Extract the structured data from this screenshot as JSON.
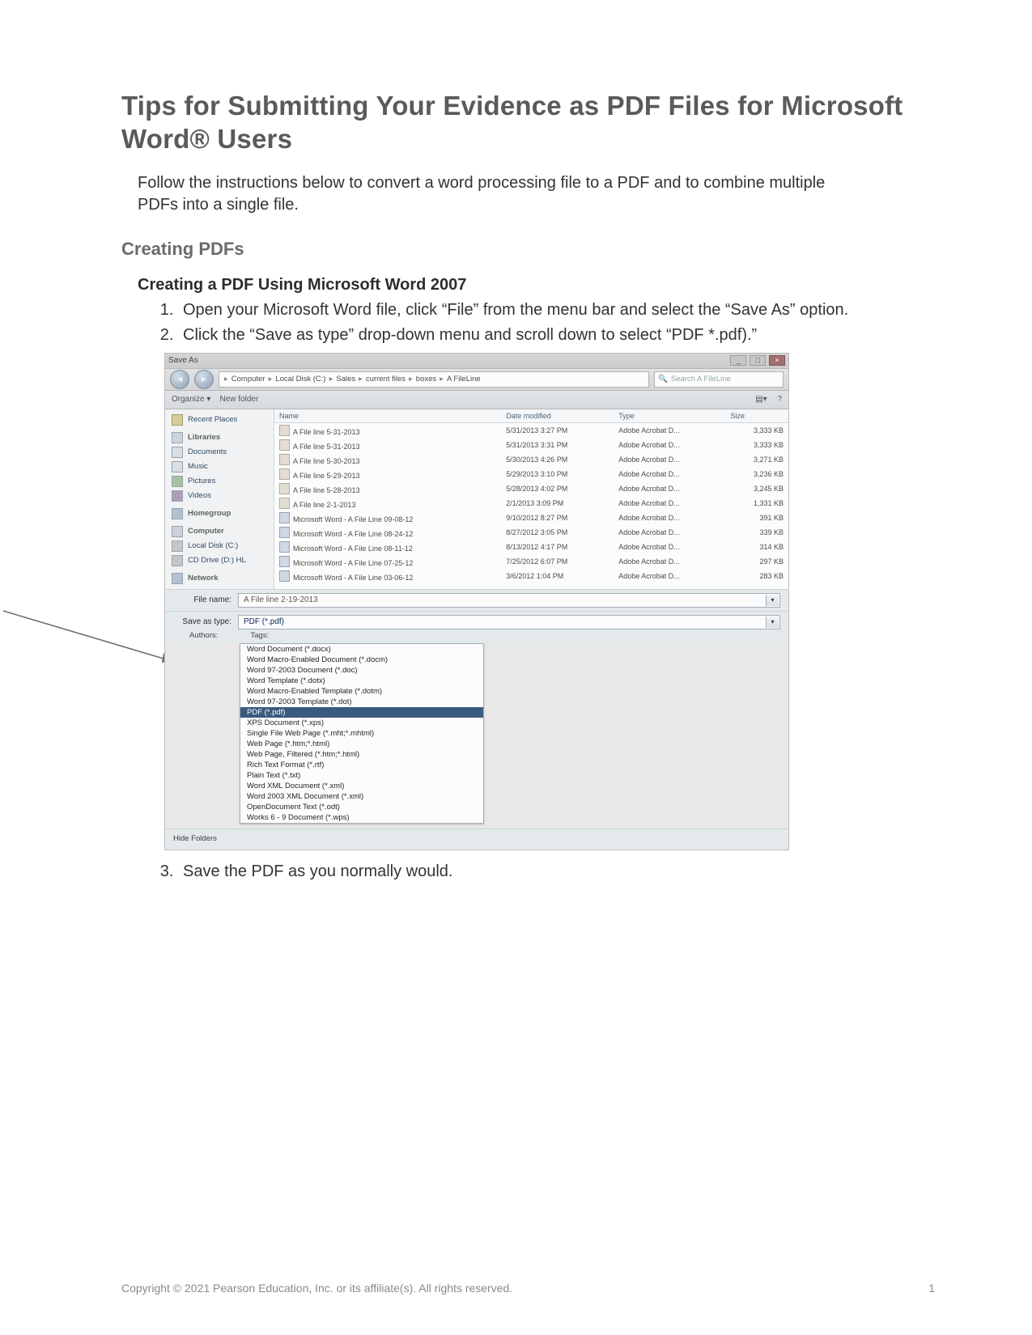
{
  "title": "Tips for Submitting Your Evidence as PDF Files for Microsoft Word® Users",
  "intro": "Follow the instructions below to convert a word processing file to a PDF and to combine multiple PDFs into a single file.",
  "section1": "Creating PDFs",
  "subsection1": "Creating a PDF Using Microsoft Word 2007",
  "steps": {
    "s1": "Open your Microsoft Word file, click “File” from the menu bar and select the “Save As” option.",
    "s2": "Click the “Save as type” drop-down menu and scroll down to select “PDF *.pdf).”",
    "s3": "Save the PDF as you normally would."
  },
  "shot": {
    "window_title": "Save As",
    "win_buttons": {
      "min": "_",
      "max": "□",
      "close": "×"
    },
    "breadcrumb": [
      "Computer",
      "Local Disk (C:)",
      "Sales",
      "current files",
      "boxes",
      "A FileLine"
    ],
    "search_placeholder": "Search A FileLine",
    "toolbar": {
      "organize": "Organize ▾",
      "newfolder": "New folder",
      "view": "▤▾",
      "help": "?"
    },
    "sidebar": {
      "recent": "Recent Places",
      "libraries": "Libraries",
      "documents": "Documents",
      "music": "Music",
      "pictures": "Pictures",
      "videos": "Videos",
      "homegroup": "Homegroup",
      "computer": "Computer",
      "localdisk": "Local Disk (C:)",
      "cd": "CD Drive (D:) HL",
      "network": "Network"
    },
    "columns": {
      "name": "Name",
      "date": "Date modified",
      "type": "Type",
      "size": "Size"
    },
    "files": [
      {
        "name": "A File line 5-31-2013",
        "date": "5/31/2013 3:27 PM",
        "type": "Adobe Acrobat D...",
        "size": "3,333 KB"
      },
      {
        "name": "A File line 5-31-2013",
        "date": "5/31/2013 3:31 PM",
        "type": "Adobe Acrobat D...",
        "size": "3,333 KB"
      },
      {
        "name": "A File line 5-30-2013",
        "date": "5/30/2013 4:26 PM",
        "type": "Adobe Acrobat D...",
        "size": "3,271 KB"
      },
      {
        "name": "A File line 5-29-2013",
        "date": "5/29/2013 3:10 PM",
        "type": "Adobe Acrobat D...",
        "size": "3,236 KB"
      },
      {
        "name": "A File line 5-28-2013",
        "date": "5/28/2013 4:02 PM",
        "type": "Adobe Acrobat D...",
        "size": "3,245 KB"
      },
      {
        "name": "A File line 2-1-2013",
        "date": "2/1/2013 3:09 PM",
        "type": "Adobe Acrobat D...",
        "size": "1,331 KB"
      },
      {
        "name": "Microsoft Word - A File Line 09-08-12",
        "date": "9/10/2012 8:27 PM",
        "type": "Adobe Acrobat D...",
        "size": "391 KB"
      },
      {
        "name": "Microsoft Word - A File Line 08-24-12",
        "date": "8/27/2012 3:05 PM",
        "type": "Adobe Acrobat D...",
        "size": "339 KB"
      },
      {
        "name": "Microsoft Word - A File Line 08-11-12",
        "date": "8/13/2012 4:17 PM",
        "type": "Adobe Acrobat D...",
        "size": "314 KB"
      },
      {
        "name": "Microsoft Word - A File Line 07-25-12",
        "date": "7/25/2012 6:07 PM",
        "type": "Adobe Acrobat D...",
        "size": "297 KB"
      },
      {
        "name": "Microsoft Word - A File Line 03-06-12",
        "date": "3/6/2012 1:04 PM",
        "type": "Adobe Acrobat D...",
        "size": "283 KB"
      }
    ],
    "filename_label": "File name:",
    "filename_value": "A File line 2-19-2013",
    "saveastype_label": "Save as type:",
    "saveastype_value": "PDF (*.pdf)",
    "authors_label": "Authors:",
    "tags_label": "Tags:",
    "type_options": [
      "Word Document (*.docx)",
      "Word Macro-Enabled Document (*.docm)",
      "Word 97-2003 Document (*.doc)",
      "Word Template (*.dotx)",
      "Word Macro-Enabled Template (*.dotm)",
      "Word 97-2003 Template (*.dot)",
      "PDF (*.pdf)",
      "XPS Document (*.xps)",
      "Single File Web Page (*.mht;*.mhtml)",
      "Web Page (*.htm;*.html)",
      "Web Page, Filtered (*.htm;*.html)",
      "Rich Text Format (*.rtf)",
      "Plain Text (*.txt)",
      "Word XML Document (*.xml)",
      "Word 2003 XML Document (*.xml)",
      "OpenDocument Text (*.odt)",
      "Works 6 - 9 Document (*.wps)"
    ],
    "hide_folders": "Hide Folders"
  },
  "footer": {
    "copyright": "Copyright © 2021 Pearson Education, Inc. or its affiliate(s). All rights reserved.",
    "page": "1"
  }
}
